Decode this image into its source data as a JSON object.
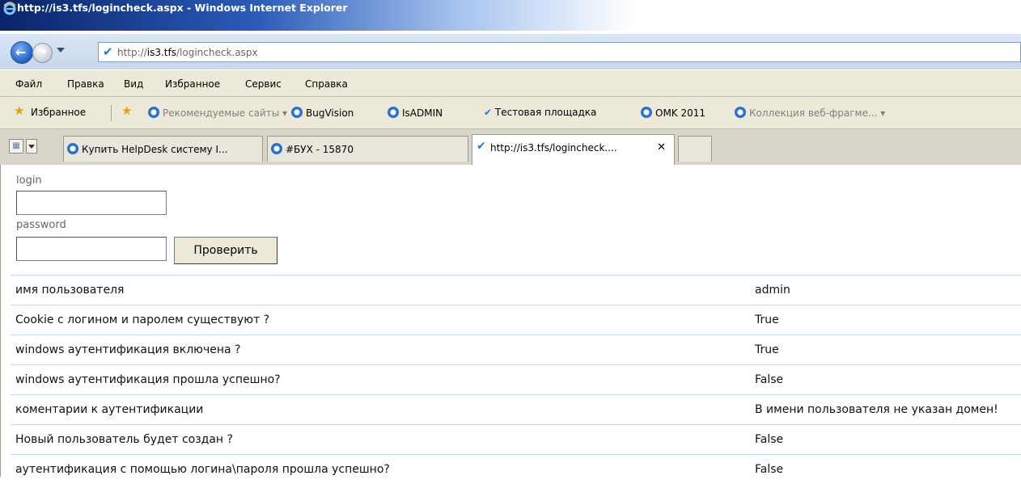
{
  "window": {
    "title": "http://is3.tfs/logincheck.aspx - Windows Internet Explorer"
  },
  "address": {
    "url_prefix": "http://",
    "url_host": "is3.tfs",
    "url_path": "/logincheck.aspx"
  },
  "menu": [
    "Файл",
    "Правка",
    "Вид",
    "Избранное",
    "Сервис",
    "Справка"
  ],
  "favorites": {
    "label": "Избранное",
    "items": [
      "Рекомендуемые сайты ▾",
      "BugVision",
      "IsADMIN",
      "Тестовая площадка",
      "OMK 2011",
      "Коллекция веб-фрагме... ▾"
    ]
  },
  "tabs": [
    {
      "label": "Купить HelpDesk систему I..."
    },
    {
      "label": "#БУХ - 15870"
    },
    {
      "label": "http://is3.tfs/logincheck...."
    }
  ],
  "form": {
    "login_label": "login",
    "password_label": "password",
    "login_value": "",
    "password_value": "",
    "submit_label": "Проверить"
  },
  "results": [
    {
      "label": "имя пользователя",
      "value": "admin"
    },
    {
      "label": "Cookie с логином и паролем существуют ?",
      "value": "True"
    },
    {
      "label": "windows аутентификация включена ?",
      "value": "True"
    },
    {
      "label": "windows аутентификация прошла успешно?",
      "value": "False"
    },
    {
      "label": "коментарии к аутентификации",
      "value": "В имени пользователя не указан домен!"
    },
    {
      "label": "Новый пользователь будет создан ?",
      "value": "False"
    },
    {
      "label": "аутентификация с помощью логина\\пароля прошла успешно?",
      "value": "False"
    }
  ]
}
